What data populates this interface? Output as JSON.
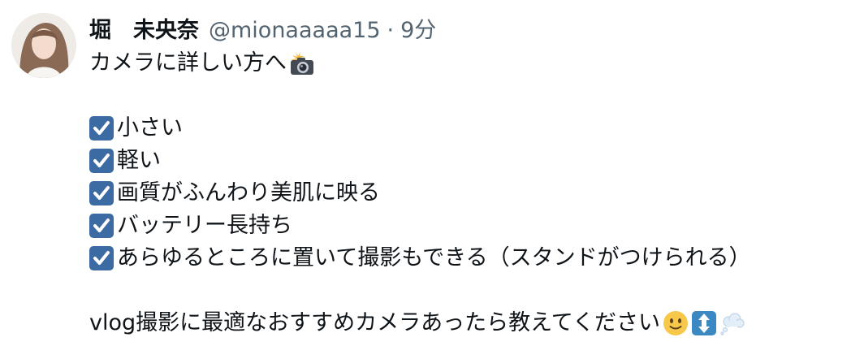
{
  "tweet": {
    "author": {
      "display_name": "堀　未央奈",
      "handle": "@mionaaaaa15",
      "separator": "·",
      "time": "9分"
    },
    "intro": "カメラに詳しい方へ",
    "intro_emoji": "camera-flash-emoji",
    "checklist_icon": "check-box-icon",
    "checklist": [
      "小さい",
      "軽い",
      "画質がふんわり美肌に映る",
      "バッテリー長持ち",
      "あらゆるところに置いて撮影もできる（スタンドがつけられる）"
    ],
    "closing": "vlog撮影に最適なおすすめカメラあったら教えてください",
    "closing_emojis": [
      "slightly-smiling-face-emoji",
      "up-down-arrow-emoji",
      "thought-balloon-emoji"
    ],
    "colors": {
      "text": "#0f1419",
      "secondary": "#536471",
      "checkbox": "#3c6aa3"
    }
  }
}
